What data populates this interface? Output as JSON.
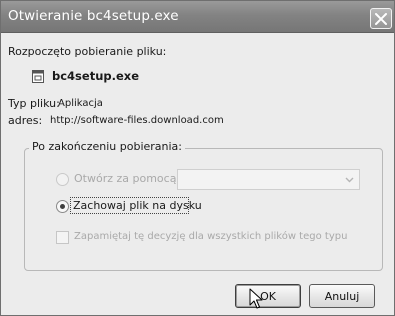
{
  "window": {
    "title": "Otwieranie bc4setup.exe"
  },
  "download": {
    "intro": "Rozpoczęto pobieranie pliku:",
    "file_name": "bc4setup.exe",
    "type_label": "Typ pliku:",
    "type_value": "Aplikacja",
    "address_label": "adres:",
    "address_value": "http://software-files.download.com"
  },
  "after_download": {
    "legend": "Po zakończeniu pobierania:",
    "open_with_label": "Otwórz za pomocą",
    "open_with_selected": false,
    "open_with_enabled": false,
    "open_with_app": "",
    "save_label": "Zachowaj plik na dysku",
    "save_selected": true,
    "remember_label": "Zapamiętaj tę decyzję dla wszystkich plików tego typu",
    "remember_checked": false,
    "remember_enabled": false
  },
  "buttons": {
    "ok": "OK",
    "cancel": "Anuluj"
  },
  "icons": {
    "close": "close-icon",
    "file": "application-file-icon",
    "dropdown": "chevron-down-icon",
    "cursor": "mouse-pointer-icon"
  }
}
